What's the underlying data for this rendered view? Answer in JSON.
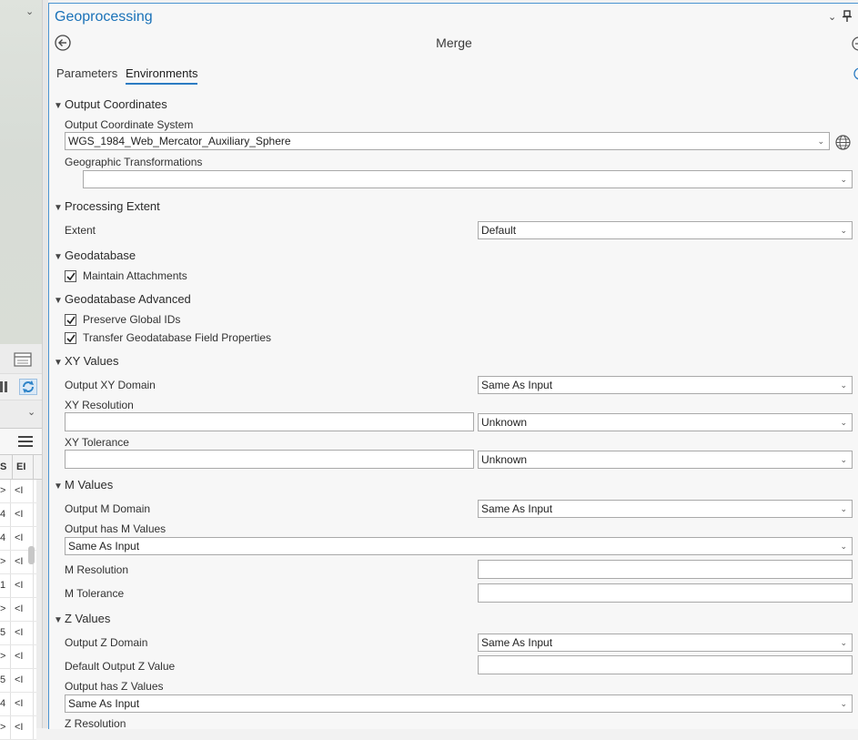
{
  "left_panel": {
    "table_columns": [
      "S",
      "EI"
    ],
    "table_rows": [
      [
        ">",
        "<I"
      ],
      [
        "4",
        "<I"
      ],
      [
        "4",
        "<I"
      ],
      [
        ">",
        "<I"
      ],
      [
        "1",
        "<I"
      ],
      [
        ">",
        "<I"
      ],
      [
        "5",
        "<I"
      ],
      [
        ">",
        "<I"
      ],
      [
        "5",
        "<I"
      ],
      [
        "4",
        "<I"
      ],
      [
        ">",
        "<I"
      ]
    ]
  },
  "pane": {
    "title": "Geoprocessing",
    "tool_title": "Merge",
    "tabs": {
      "parameters": "Parameters",
      "environments": "Environments"
    }
  },
  "sections": {
    "output_coordinates": {
      "header": "Output Coordinates",
      "ocs_label": "Output Coordinate System",
      "ocs_value": "WGS_1984_Web_Mercator_Auxiliary_Sphere",
      "geo_trans_label": "Geographic Transformations",
      "geo_trans_value": ""
    },
    "processing_extent": {
      "header": "Processing Extent",
      "extent_label": "Extent",
      "extent_value": "Default"
    },
    "geodatabase": {
      "header": "Geodatabase",
      "maintain_attachments": "Maintain Attachments",
      "maintain_attachments_checked": true
    },
    "geodatabase_advanced": {
      "header": "Geodatabase Advanced",
      "preserve_global_ids": "Preserve Global IDs",
      "preserve_global_ids_checked": true,
      "transfer_field_props": "Transfer Geodatabase Field Properties",
      "transfer_field_props_checked": true
    },
    "xy_values": {
      "header": "XY Values",
      "domain_label": "Output XY Domain",
      "domain_value": "Same As Input",
      "resolution_label": "XY Resolution",
      "resolution_value": "",
      "resolution_unit": "Unknown",
      "tolerance_label": "XY Tolerance",
      "tolerance_value": "",
      "tolerance_unit": "Unknown"
    },
    "m_values": {
      "header": "M Values",
      "domain_label": "Output M Domain",
      "domain_value": "Same As Input",
      "has_m_label": "Output has M Values",
      "has_m_value": "Same As Input",
      "resolution_label": "M Resolution",
      "resolution_value": "",
      "tolerance_label": "M Tolerance",
      "tolerance_value": ""
    },
    "z_values": {
      "header": "Z Values",
      "domain_label": "Output Z Domain",
      "domain_value": "Same As Input",
      "default_z_label": "Default Output Z Value",
      "default_z_value": "",
      "has_z_label": "Output has Z Values",
      "has_z_value": "Same As Input",
      "resolution_label": "Z Resolution"
    }
  },
  "colors": {
    "accent": "#1a72b8",
    "tab_underline": "#2c7cc3",
    "pane_border": "#4a94d1",
    "refresh_icon": "#2f84c8"
  }
}
